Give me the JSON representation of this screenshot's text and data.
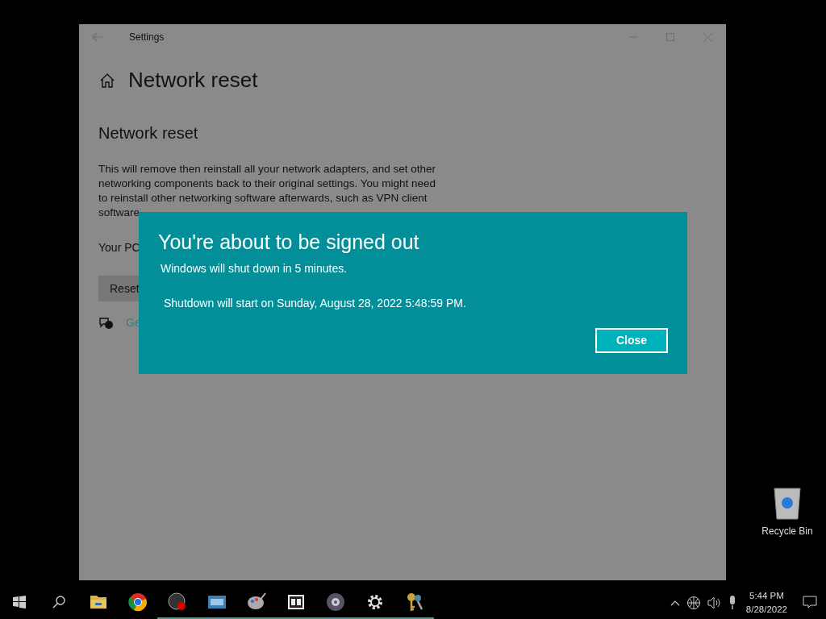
{
  "window": {
    "title": "Settings",
    "page_title": "Network reset"
  },
  "content": {
    "heading": "Network reset",
    "paragraph": "This will remove then reinstall all your network adapters, and set other networking components back to their original settings. You might need to reinstall other networking software afterwards, such as VPN client software",
    "status": "Your PC",
    "button": "Reset",
    "help_link": "Ge"
  },
  "dialog": {
    "title": "You're about to be signed out",
    "message": "Windows will shut down in 5 minutes.",
    "detail": "Shutdown will start on Sunday, August 28, 2022 5:48:59 PM.",
    "button": "Close"
  },
  "desktop_icons": [
    {
      "label": "Recycle Bin"
    }
  ],
  "taskbar": {
    "apps": [
      {
        "kind": "folder",
        "running": false
      },
      {
        "kind": "chrome",
        "running": false
      },
      {
        "kind": "obs",
        "running": true
      },
      {
        "kind": "network",
        "running": true
      },
      {
        "kind": "paint",
        "running": true
      },
      {
        "kind": "zip",
        "running": true
      },
      {
        "kind": "disc",
        "running": true
      },
      {
        "kind": "gear",
        "running": true
      },
      {
        "kind": "keys",
        "running": true
      }
    ],
    "time": "5:44 PM",
    "date": "8/28/2022"
  }
}
